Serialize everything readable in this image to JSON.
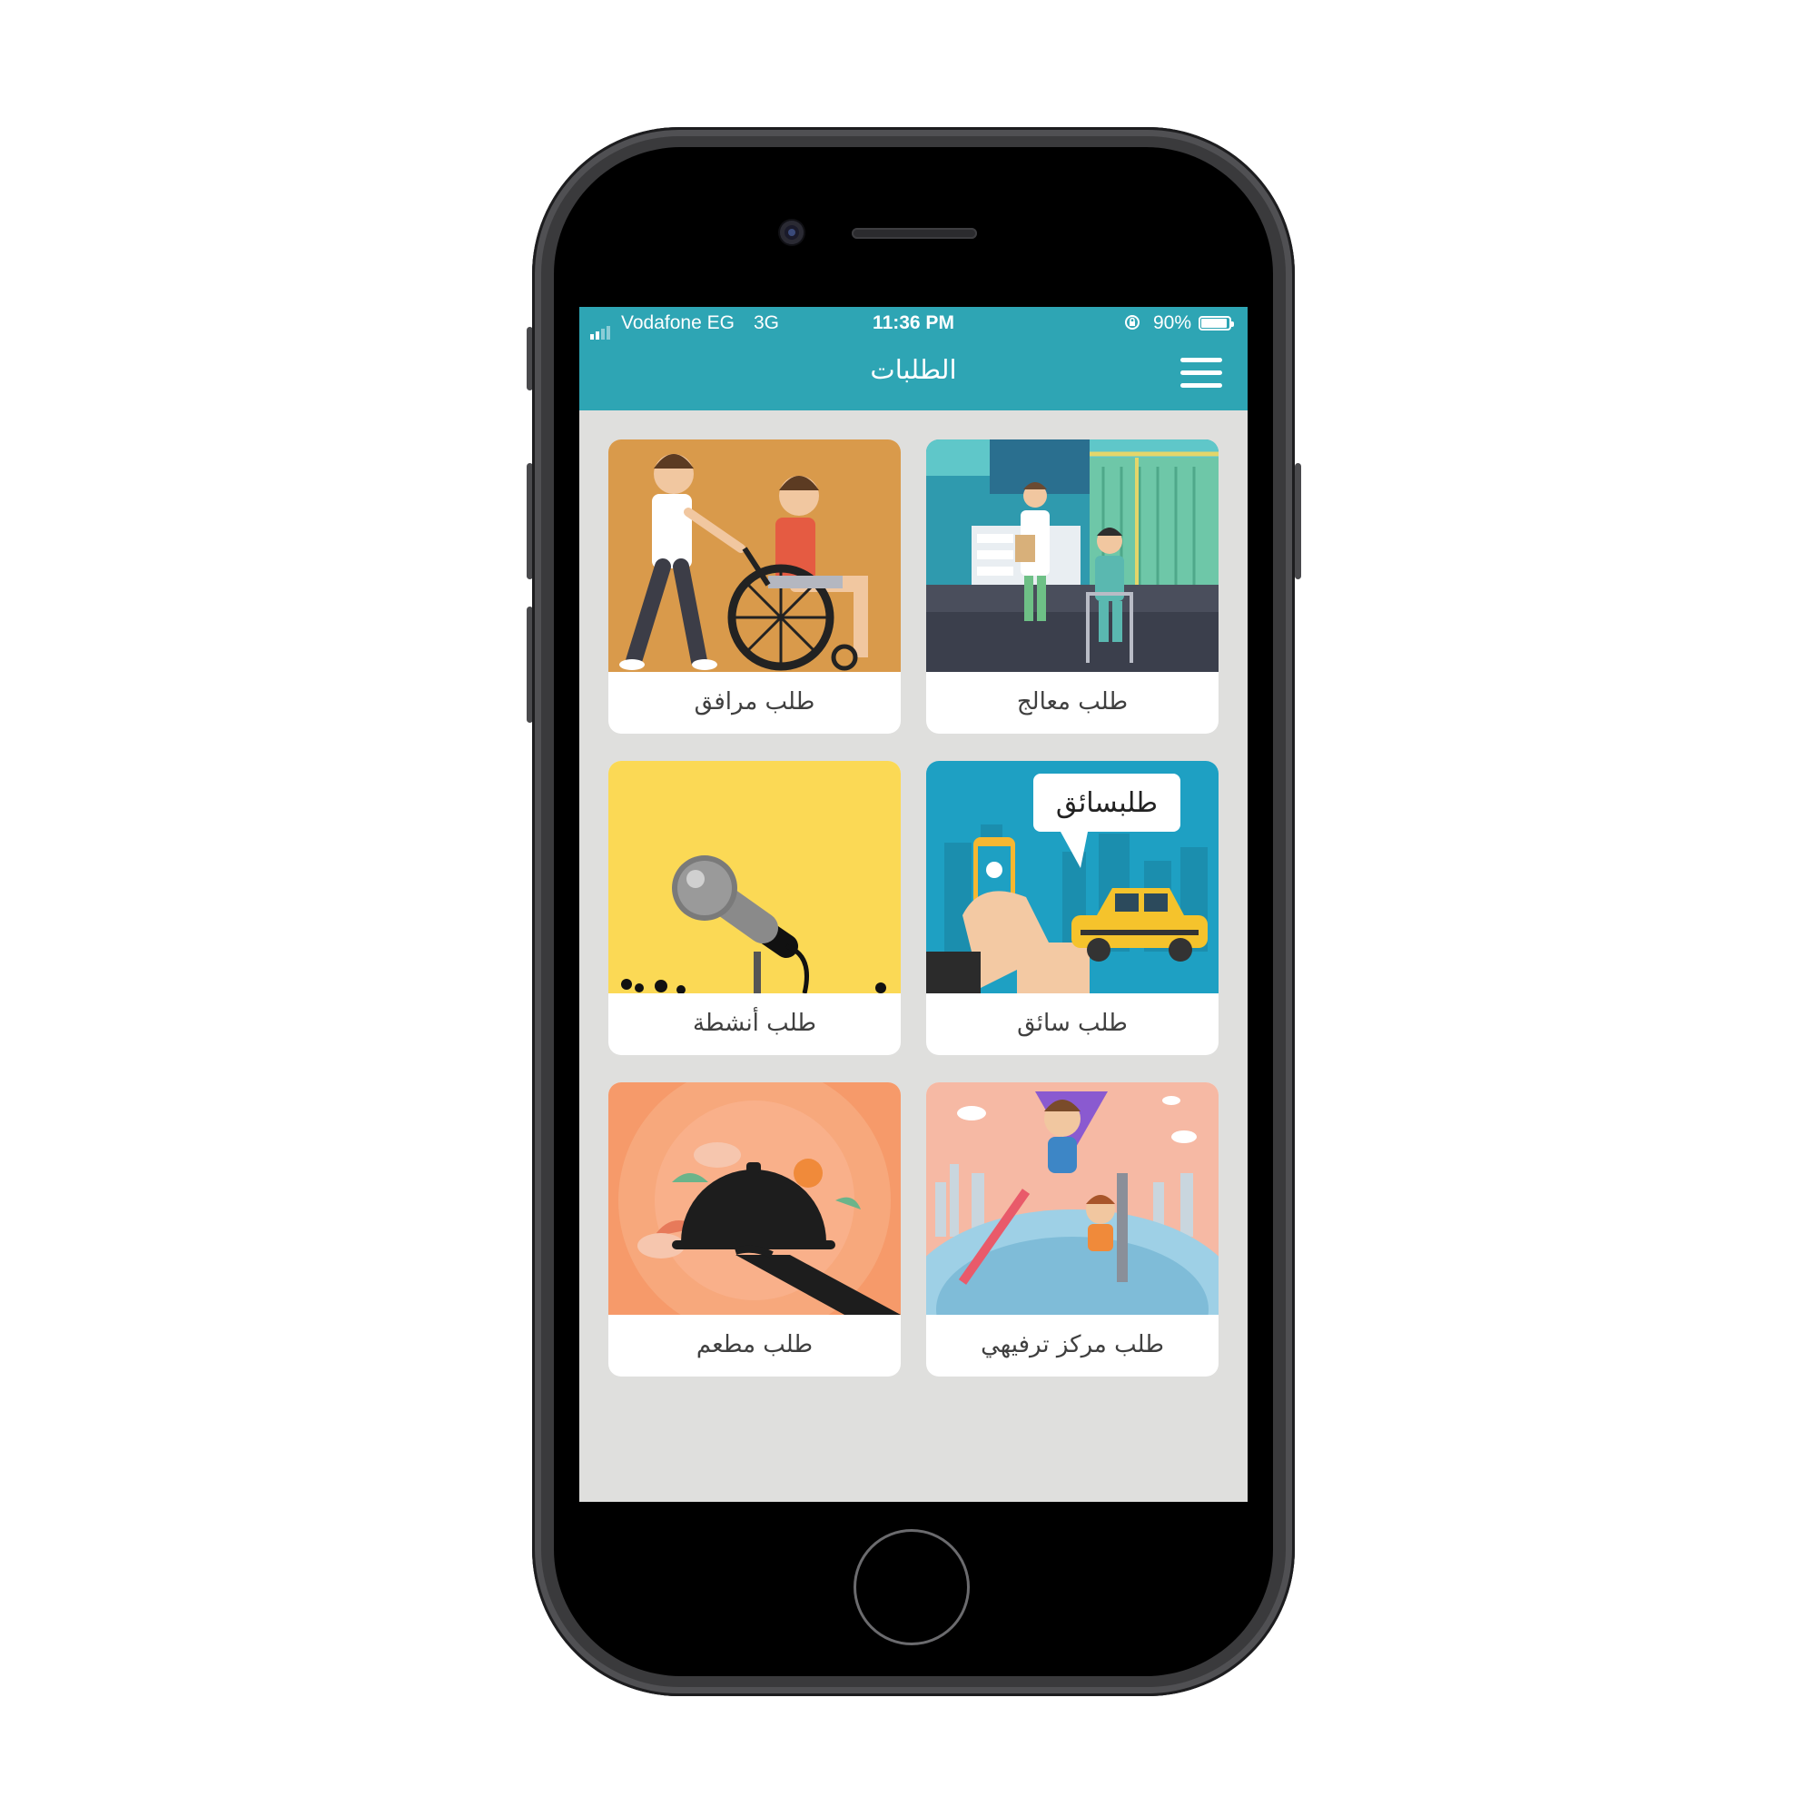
{
  "status_bar": {
    "carrier": "Vodafone EG",
    "network": "3G",
    "time": "11:36 PM",
    "battery": "90%"
  },
  "header": {
    "title": "الطلبات",
    "menu_icon": "hamburger-menu-icon",
    "background": "#2ea5b4"
  },
  "requests": [
    {
      "label": "طلب معالج",
      "illustration": "doctor-patient-illustration"
    },
    {
      "label": "طلب مرافق",
      "illustration": "wheelchair-companion-illustration"
    },
    {
      "label": "طلب سائق",
      "illustration": "taxi-app-illustration",
      "bubble_text": "طلبسائق"
    },
    {
      "label": "طلب أنشطة",
      "illustration": "microphone-illustration"
    },
    {
      "label": "طلب مركز ترفيهي",
      "illustration": "amusement-kids-illustration"
    },
    {
      "label": "طلب مطعم",
      "illustration": "restaurant-cloche-illustration"
    }
  ]
}
